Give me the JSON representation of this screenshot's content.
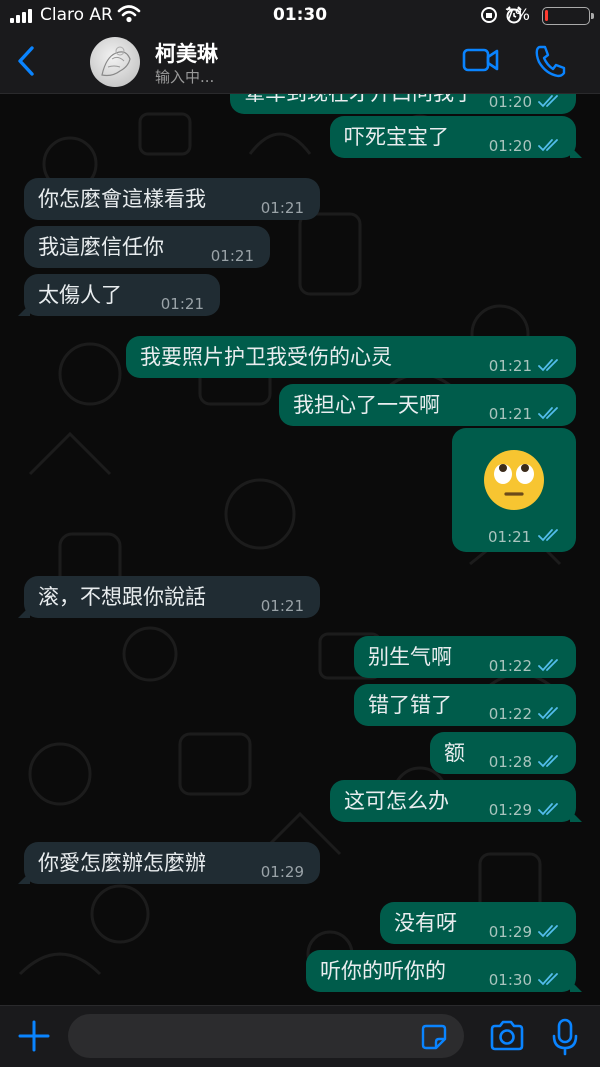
{
  "status_bar": {
    "carrier": "Claro AR",
    "time": "01:30",
    "battery_percent": "7%",
    "battery_level": 0.07
  },
  "header": {
    "contact_name": "柯美琳",
    "status": "输入中..."
  },
  "messages": [
    {
      "dir": "out",
      "text": "晕车到现在才开口问我了",
      "time": "01:20",
      "read": true
    },
    {
      "dir": "out",
      "text": "吓死宝宝了",
      "time": "01:20",
      "read": true
    },
    {
      "dir": "in",
      "text": "你怎麼會這樣看我",
      "time": "01:21"
    },
    {
      "dir": "in",
      "text": "我這麼信任你",
      "time": "01:21"
    },
    {
      "dir": "in",
      "text": "太傷人了",
      "time": "01:21"
    },
    {
      "dir": "out",
      "text": "我要照片护卫我受伤的心灵",
      "time": "01:21",
      "read": true
    },
    {
      "dir": "out",
      "text": "我担心了一天啊",
      "time": "01:21",
      "read": true
    },
    {
      "dir": "out",
      "text": "🙄",
      "time": "01:21",
      "read": true,
      "emoji": true
    },
    {
      "dir": "in",
      "text": "滚，不想跟你說話",
      "time": "01:21"
    },
    {
      "dir": "out",
      "text": "别生气啊",
      "time": "01:22",
      "read": true
    },
    {
      "dir": "out",
      "text": "错了错了",
      "time": "01:22",
      "read": true
    },
    {
      "dir": "out",
      "text": "额",
      "time": "01:28",
      "read": true
    },
    {
      "dir": "out",
      "text": "这可怎么办",
      "time": "01:29",
      "read": true
    },
    {
      "dir": "in",
      "text": "你愛怎麼辦怎麼辦",
      "time": "01:29"
    },
    {
      "dir": "out",
      "text": "没有呀",
      "time": "01:29",
      "read": true
    },
    {
      "dir": "out",
      "text": "听你的听你的",
      "time": "01:30",
      "read": true
    }
  ],
  "input": {
    "placeholder": ""
  },
  "colors": {
    "accent": "#0a84ff",
    "outgoing": "#005c4b",
    "incoming": "#202c33",
    "read_ticks": "#53bdeb"
  },
  "icons": [
    "back-chevron-icon",
    "video-call-icon",
    "phone-call-icon",
    "plus-icon",
    "sticker-icon",
    "camera-icon",
    "microphone-icon"
  ]
}
